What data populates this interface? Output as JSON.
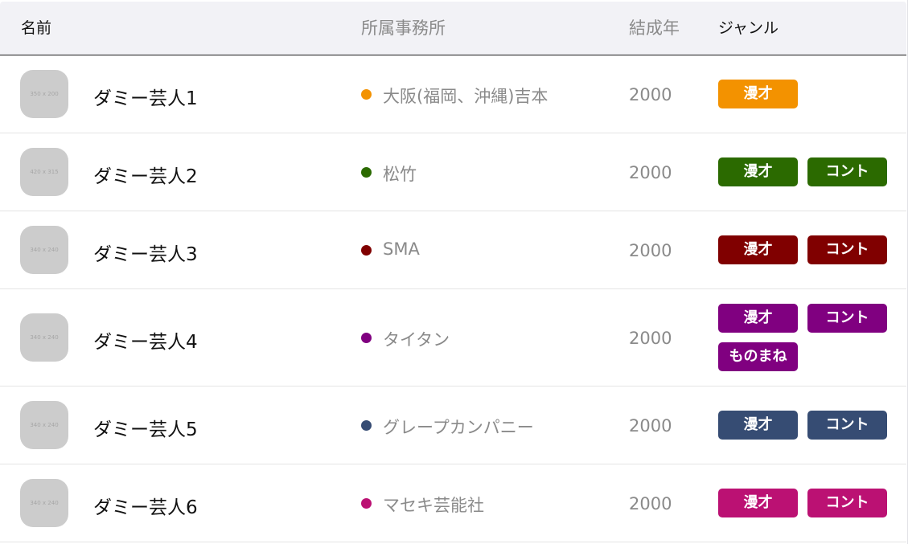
{
  "header": {
    "name": "名前",
    "agency": "所属事務所",
    "year": "結成年",
    "genre": "ジャンル"
  },
  "rows": [
    {
      "thumb_text": "350 x 200",
      "name": "ダミー芸人1",
      "agency": "大阪(福岡、沖縄)吉本",
      "agency_color": "#f39200",
      "year": "2000",
      "genres": [
        "漫才"
      ]
    },
    {
      "thumb_text": "420 x 315",
      "name": "ダミー芸人2",
      "agency": "松竹",
      "agency_color": "#2b6a00",
      "year": "2000",
      "genres": [
        "漫才",
        "コント"
      ]
    },
    {
      "thumb_text": "340 x 240",
      "name": "ダミー芸人3",
      "agency": "SMA",
      "agency_color": "#800000",
      "year": "2000",
      "genres": [
        "漫才",
        "コント"
      ]
    },
    {
      "thumb_text": "340 x 240",
      "name": "ダミー芸人4",
      "agency": "タイタン",
      "agency_color": "#800080",
      "year": "2000",
      "genres": [
        "漫才",
        "コント",
        "ものまね"
      ]
    },
    {
      "thumb_text": "340 x 240",
      "name": "ダミー芸人5",
      "agency": "グレープカンパニー",
      "agency_color": "#364c73",
      "year": "2000",
      "genres": [
        "漫才",
        "コント"
      ]
    },
    {
      "thumb_text": "340 x 240",
      "name": "ダミー芸人6",
      "agency": "マセキ芸能社",
      "agency_color": "#bb1173",
      "year": "2000",
      "genres": [
        "漫才",
        "コント"
      ]
    }
  ]
}
